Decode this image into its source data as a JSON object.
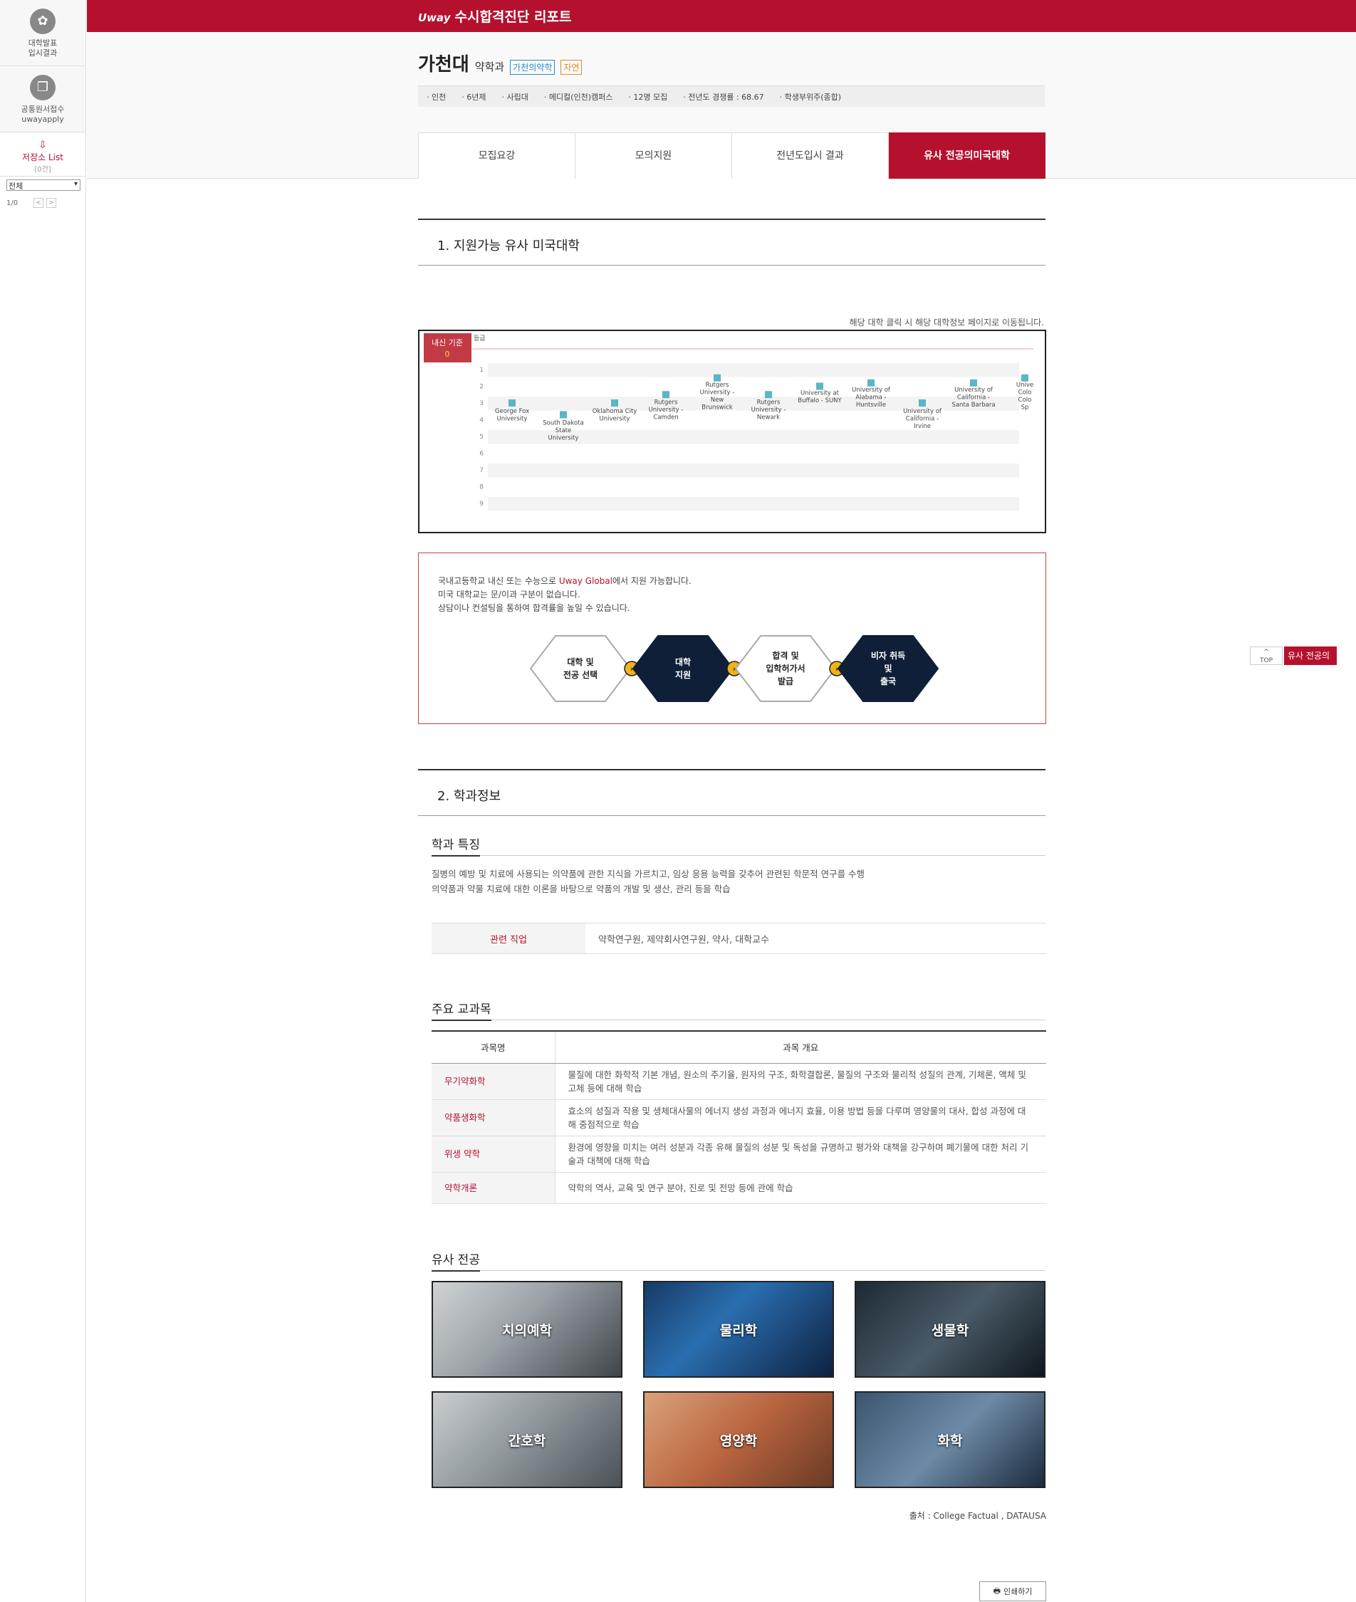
{
  "sidebar": {
    "results_label_1": "대학발표",
    "results_label_2": "입시결과",
    "apply_label_1": "공통원서접수",
    "apply_label_2": "uwayapply",
    "save_label": "저장소 List",
    "save_count": "[0건]",
    "filter_value": "전체",
    "page_text": "1/0",
    "prev": "<",
    "next": ">"
  },
  "topbar": {
    "logo": "Uway",
    "title": "수시합격진단 리포트"
  },
  "header": {
    "univ": "가천대",
    "dept": "약학과",
    "tag1": "가천의약학",
    "tag2": "자연",
    "info": [
      "· 인천",
      "· 6년제",
      "· 사립대",
      "· 메디컬(인천)캠퍼스",
      "· 12명 모집",
      "· 전년도 경쟁률 : 68.67",
      "· 학생부위주(종합)"
    ]
  },
  "tabs": [
    "모집요강",
    "모의지원",
    "전년도\n입시 결과",
    "유사 전공의\n미국대학"
  ],
  "section1": {
    "title": "1. 지원가능 유사 미국대학",
    "note": "해당 대학 클릭 시 해당 대학정보 페이지로 이동됩니다."
  },
  "chart_data": {
    "type": "scatter",
    "badge_label": "내신 기준",
    "badge_value": "0",
    "ylabel": "등급",
    "y_ticks": [
      "1",
      "2",
      "3",
      "4",
      "5",
      "6",
      "7",
      "8",
      "9"
    ],
    "ylim": [
      1,
      9
    ],
    "y_inverted": true,
    "points": [
      {
        "name": [
          "George Fox",
          "University"
        ],
        "y": 3.0
      },
      {
        "name": [
          "South Dakota",
          "State",
          "University"
        ],
        "y": 3.7
      },
      {
        "name": [
          "Oklahoma City",
          "University"
        ],
        "y": 3.0
      },
      {
        "name": [
          "Rutgers",
          "University -",
          "Camden"
        ],
        "y": 2.5
      },
      {
        "name": [
          "Rutgers",
          "University -",
          "New",
          "Brunswick"
        ],
        "y": 1.5
      },
      {
        "name": [
          "Rutgers",
          "University -",
          "Newark"
        ],
        "y": 2.5
      },
      {
        "name": [
          "University at",
          "Buffalo - SUNY"
        ],
        "y": 2.0
      },
      {
        "name": [
          "University of",
          "Alabama -",
          "Huntsville"
        ],
        "y": 1.8
      },
      {
        "name": [
          "University of",
          "California -",
          "Irvine"
        ],
        "y": 3.0
      },
      {
        "name": [
          "University of",
          "California -",
          "Santa Barbara"
        ],
        "y": 1.8
      },
      {
        "name": [
          "Unive",
          "Colo",
          "Colo",
          "Sp"
        ],
        "y": 1.5
      }
    ]
  },
  "info_box": {
    "line1_pre": "국내고등학교 내신 또는 수능으로 ",
    "line1_hl": "Uway Global",
    "line1_post": "에서 지원 가능합니다.",
    "line2": "미국 대학교는 문/이과 구분이 없습니다.",
    "line3": "상담이나 컨설팅을 통하여 합격률을 높일 수 있습니다.",
    "steps": [
      [
        "대학 및",
        "전공 선택"
      ],
      [
        "대학",
        "지원"
      ],
      [
        "합격 및",
        "입학허가서",
        "발급"
      ],
      [
        "비자 취득",
        "및",
        "출국"
      ]
    ]
  },
  "section2": {
    "title": "2. 학과정보",
    "feature_title": "학과 특징",
    "feature_line1": "질병의 예방 및 치료에 사용되는 의약품에 관한 지식을 가르치고, 임상 응용 능력을 갖추어 관련된 학문적 연구를 수행",
    "feature_line2": "의약품과 약물 치료에 대한 이론을 바탕으로 약품의 개발 및 생산, 관리 등을 학습",
    "job_label": "관련 직업",
    "job_value": "약학연구원, 제약회사연구원, 약사, 대학교수",
    "courses_title": "주요 교과목",
    "course_headers": [
      "과목명",
      "과목 개요"
    ],
    "courses": [
      {
        "name": "무기약화학",
        "desc": "물질에 대한 화학적 기본 개념, 원소의 주기율, 원자의 구조, 화학결합론, 물질의 구조와 물리적 성질의 관계, 기체론, 액체 및 고체 등에 대해 학습"
      },
      {
        "name": "약품생화학",
        "desc": "효소의 성질과 작용 및 생체대사물의 에너지 생성 과정과 에너지 효율, 이용 방법 등을 다루며 영양물의 대사, 합성 과정에 대해 중점적으로 학습"
      },
      {
        "name": "위생 약학",
        "desc": "환경에 영향을 미치는 여러 성분과 각종 유해 물질의 성분 및 독성을 규명하고 평가와 대책을 강구하며 폐기물에 대한 처리 기술과 대책에 대해 학습"
      },
      {
        "name": "약학개론",
        "desc": "약학의 역사, 교육 및 연구 분야, 진로 및 전망 등에 관에 학습"
      }
    ],
    "similar_title": "유사 전공",
    "majors": [
      "치의예학",
      "물리학",
      "생물학",
      "간호학",
      "영양학",
      "화학"
    ]
  },
  "source": "출처 : College Factual , DATAUSA",
  "print_label": "인쇄하기",
  "float": {
    "top": "TOP",
    "tab": "유사 전공의"
  },
  "colors": {
    "accent": "#b5112e",
    "marker": "#5bb5c7",
    "hex_dark": "#0f1f38",
    "hex_arrow": "#f2b315"
  }
}
